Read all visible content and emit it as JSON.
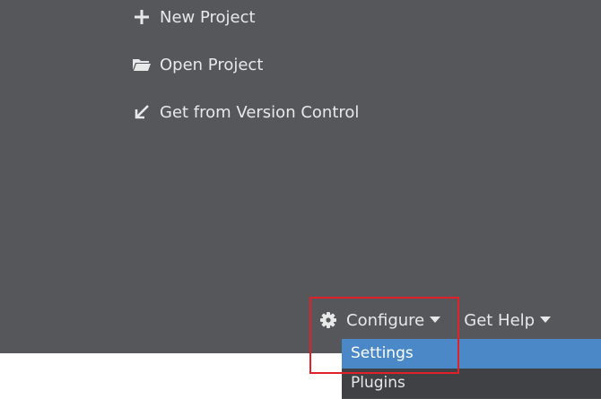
{
  "welcome": {
    "actions": [
      {
        "label": "New Project",
        "icon": "plus-icon"
      },
      {
        "label": "Open Project",
        "icon": "folder-open-icon"
      },
      {
        "label": "Get from Version Control",
        "icon": "arrow-down-left-icon"
      }
    ]
  },
  "bottom_bar": {
    "configure_label": "Configure",
    "get_help_label": "Get Help",
    "configure_icon": "gear-icon"
  },
  "dropdown": {
    "items": [
      {
        "label": "Settings",
        "selected": true
      },
      {
        "label": "Plugins",
        "selected": false
      }
    ]
  },
  "colors": {
    "panel_bg": "#55575b",
    "text": "#e8e8e8",
    "selection": "#4a88c7",
    "highlight_box": "#e0212a"
  }
}
